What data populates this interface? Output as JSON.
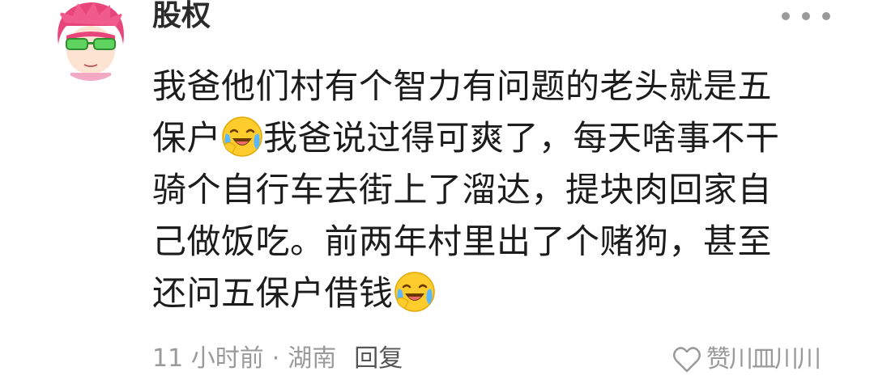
{
  "comment": {
    "username": "股权",
    "avatar_icon": "anime-avatar-pink-hair-green-glasses",
    "more_icon": "more-dots-icon",
    "text": {
      "line1": "我爸他们村有个智力有问题的老头就是五",
      "line2_before_emoji": "保户",
      "line2_emoji": "laughing-crying-emoji",
      "line2_after_emoji": "我爸说过得可爽了，每天啥事不干",
      "line3": "骑个自行车去街上了溜达，提块肉回家自",
      "line4": "己做饭吃。前两年村里出了个赌狗，甚至",
      "line5_before_emoji": "还问五保户借钱",
      "line5_emoji": "laughing-crying-emoji"
    },
    "meta": {
      "time": "11 小时前",
      "separator": "·",
      "location": "湖南",
      "reply_label": "回复"
    },
    "like": {
      "icon": "heart-outline-icon",
      "label": "赞川皿川川"
    }
  }
}
